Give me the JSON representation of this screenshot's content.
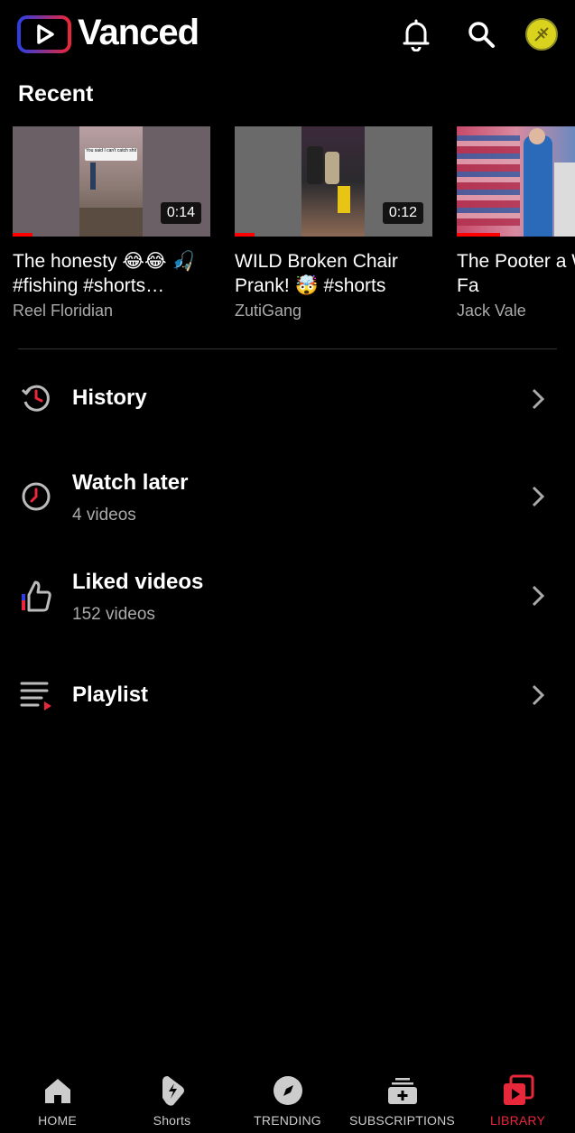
{
  "header": {
    "app_name": "Vanced",
    "icons": [
      "notifications-icon",
      "search-icon",
      "account-avatar"
    ]
  },
  "recent": {
    "title": "Recent",
    "videos": [
      {
        "title": "The honesty 😂😂 🎣 #fishing #shorts…",
        "channel": "Reel Floridian",
        "duration": "0:14",
        "progress": 0.1,
        "thumb_overlay": "You said I can't catch shit"
      },
      {
        "title": "WILD Broken Chair Prank! 🤯 #shorts",
        "channel": "ZutiGang",
        "duration": "0:12",
        "progress": 0.1
      },
      {
        "title": "The Pooter a Walmart! - Fa",
        "channel": "Jack Vale",
        "duration": "",
        "progress": 0.22
      }
    ]
  },
  "library": {
    "items": [
      {
        "label": "History",
        "sub": "",
        "icon": "history-icon"
      },
      {
        "label": "Watch later",
        "sub": "4 videos",
        "icon": "clock-icon"
      },
      {
        "label": "Liked videos",
        "sub": "152 videos",
        "icon": "thumbs-up-icon"
      },
      {
        "label": "Playlist",
        "sub": "",
        "icon": "playlist-icon"
      }
    ]
  },
  "nav": {
    "items": [
      {
        "label": "HOME",
        "icon": "home-icon",
        "active": false
      },
      {
        "label": "Shorts",
        "icon": "shorts-icon",
        "active": false
      },
      {
        "label": "TRENDING",
        "icon": "trending-icon",
        "active": false
      },
      {
        "label": "SUBSCRIPTIONS",
        "icon": "subscriptions-icon",
        "active": false
      },
      {
        "label": "LIBRARY",
        "icon": "library-icon",
        "active": true
      }
    ]
  },
  "colors": {
    "background": "#000000",
    "accent": "#e8273a",
    "progress": "#ff0000",
    "secondary_text": "#aaaaaa",
    "logo_red": "#e8273a",
    "logo_blue": "#3a3ad8"
  }
}
